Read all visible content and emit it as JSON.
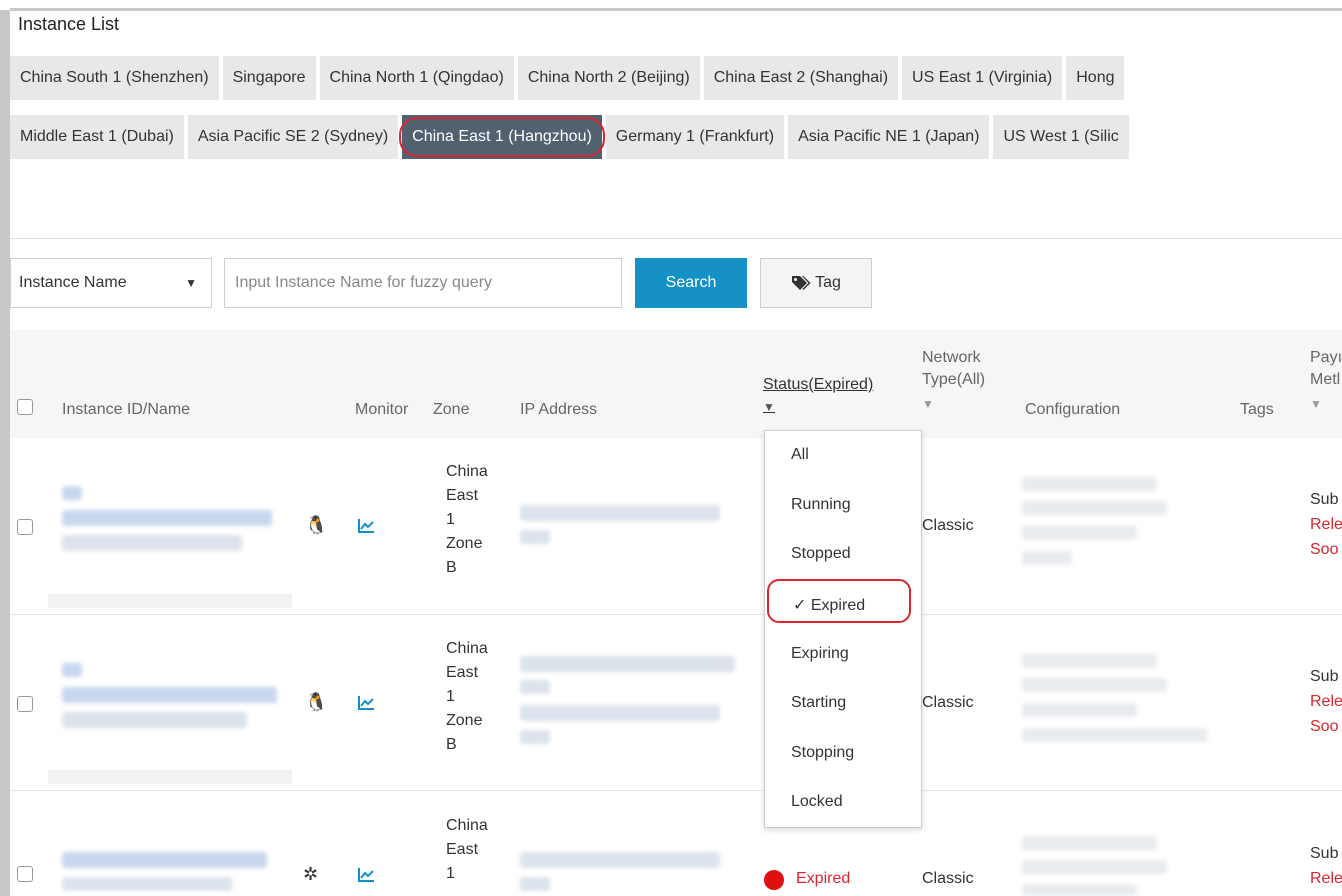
{
  "title": "Instance List",
  "regions_row1": [
    "China South 1 (Shenzhen)",
    "Singapore",
    "China North 1 (Qingdao)",
    "China North 2 (Beijing)",
    "China East 2 (Shanghai)",
    "US East 1 (Virginia)",
    "Hong"
  ],
  "regions_row2": [
    "Middle East 1 (Dubai)",
    "Asia Pacific SE 2 (Sydney)",
    "China East 1 (Hangzhou)",
    "Germany 1 (Frankfurt)",
    "Asia Pacific NE 1 (Japan)",
    "US West 1 (Silic"
  ],
  "active_region": "China East 1 (Hangzhou)",
  "search": {
    "select_value": "Instance Name",
    "placeholder": "Input Instance Name for fuzzy query",
    "search_label": "Search",
    "tag_label": "Tag"
  },
  "table": {
    "headers": {
      "instance": "Instance ID/Name",
      "monitor": "Monitor",
      "zone": "Zone",
      "ip": "IP Address",
      "status": "Status(Expired)",
      "network_line1": "Network",
      "network_line2": "Type(All)",
      "configuration": "Configuration",
      "tags": "Tags",
      "payment_line1": "Payı",
      "payment_line2": "Metl"
    },
    "rows": [
      {
        "zone": [
          "China",
          "East",
          "1",
          "Zone",
          "B"
        ],
        "network": "Classic",
        "payment": [
          "Sub",
          "Rele",
          "Soo"
        ]
      },
      {
        "zone": [
          "China",
          "East",
          "1",
          "Zone",
          "B"
        ],
        "network": "Classic",
        "payment": [
          "Sub",
          "Rele",
          "Soo"
        ]
      },
      {
        "zone": [
          "China",
          "East",
          "1"
        ],
        "status": "Expired",
        "network": "Classic",
        "payment": [
          "Sub",
          "Rele"
        ]
      }
    ]
  },
  "status_dropdown": {
    "options": [
      "All",
      "Running",
      "Stopped",
      "Expired",
      "Expiring",
      "Starting",
      "Stopping",
      "Locked"
    ],
    "selected": "Expired",
    "selected_check": "✓"
  },
  "colors": {
    "accent": "#1591c8",
    "active_tab": "#526170",
    "highlight": "#d9262e"
  }
}
